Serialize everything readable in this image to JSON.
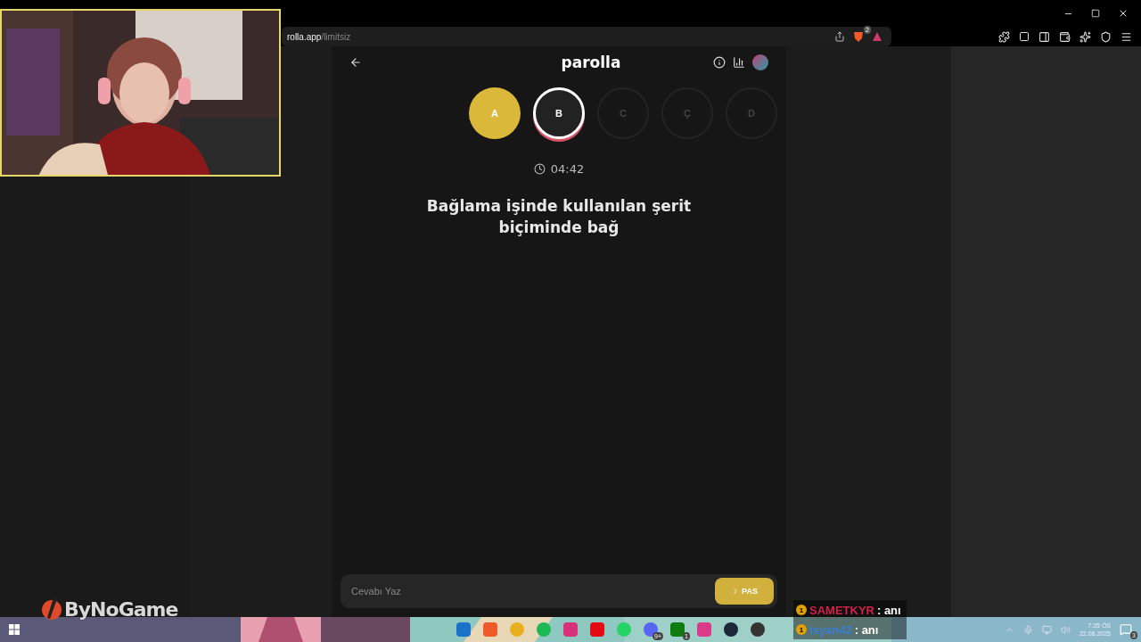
{
  "browser": {
    "url_host": "rolla.app",
    "url_path": "/limitsiz",
    "extension_badge": "2"
  },
  "app": {
    "title": "parolla",
    "letters": [
      {
        "label": "A",
        "answered": true,
        "selected": false
      },
      {
        "label": "B",
        "answered": false,
        "selected": true
      },
      {
        "label": "C",
        "answered": false,
        "selected": false
      },
      {
        "label": "Ç",
        "answered": false,
        "selected": false
      },
      {
        "label": "D",
        "answered": false,
        "selected": false
      }
    ],
    "timer": "04:42",
    "question": "Bağlama işinde kullanılan şerit biçiminde bağ",
    "answer": {
      "placeholder": "Cevabı Yaz"
    },
    "pass_button": "PAS"
  },
  "logo": "ByNoGame",
  "chat": [
    {
      "badge": "1",
      "user": "SAMETKYR",
      "color": "#d4204a",
      "message": ": anı"
    },
    {
      "badge": "1",
      "user": "isyan42",
      "color": "#3a7fd6",
      "message": ": anı"
    }
  ],
  "taskbar": {
    "discord_badge": "9+",
    "xbox_badge": "1",
    "time": "7:25 ÖS",
    "date": "22.08.2025",
    "notifications": "3"
  }
}
